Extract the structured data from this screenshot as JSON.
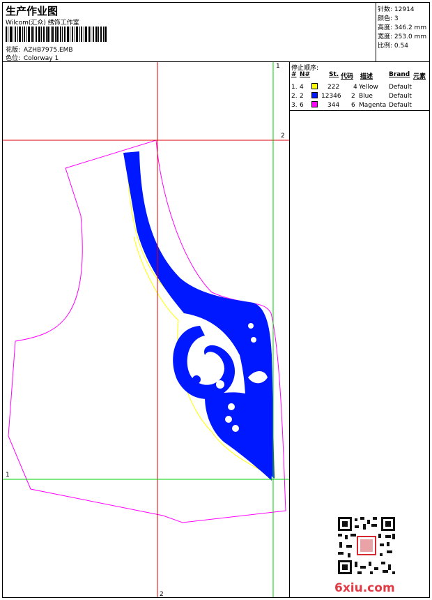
{
  "header": {
    "title": "生产作业图",
    "company": "Wilcom(汇众) 绣饰工作室",
    "design_label": "花版:",
    "design_value": "AZHB7975.EMB",
    "colorway_label": "色位:",
    "colorway_value": "Colorway 1"
  },
  "meta": {
    "stitches_label": "针数:",
    "stitches_value": "12914",
    "colors_label": "颜色:",
    "colors_value": "3",
    "height_label": "高度:",
    "height_value": "346.2 mm",
    "width_label": "宽度:",
    "width_value": "253.0 mm",
    "scale_label": "比例:",
    "scale_value": "0.54"
  },
  "sequence": {
    "caption": "停止顺序:",
    "headers": [
      "#",
      "N#",
      "St.",
      "代码",
      "描述",
      "Brand",
      "元素"
    ],
    "rows": [
      {
        "idx": "1.",
        "n": "4",
        "st": "222",
        "code": "4",
        "desc": "Yellow",
        "brand": "Default",
        "color": "#ffff00"
      },
      {
        "idx": "2.",
        "n": "2",
        "st": "12346",
        "code": "2",
        "desc": "Blue",
        "brand": "Default",
        "color": "#0018ff"
      },
      {
        "idx": "3.",
        "n": "6",
        "st": "344",
        "code": "6",
        "desc": "Magenta",
        "brand": "Default",
        "color": "#ff00ff"
      }
    ]
  },
  "guides": {
    "v_green": "1",
    "h_red": "2",
    "h_green": "1",
    "v_red": "2"
  },
  "colors": {
    "yellow": "#ffff00",
    "blue": "#0018ff",
    "magenta": "#ff00ff",
    "red": "#e00000",
    "green": "#00d000",
    "watermark": "#e23a45"
  },
  "watermark": "6xiu.com"
}
